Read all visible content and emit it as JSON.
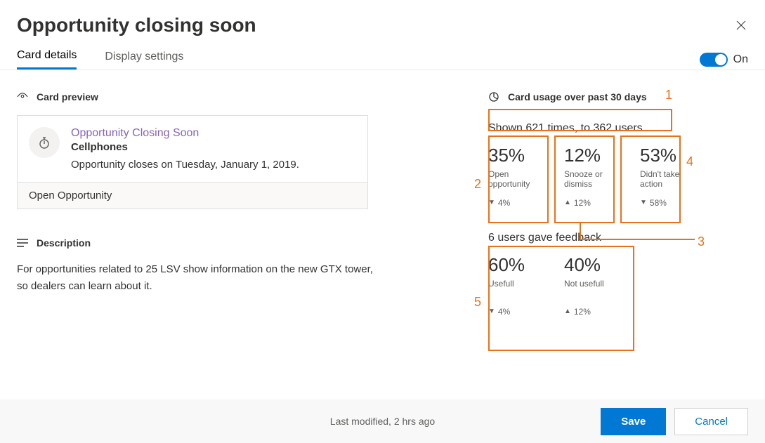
{
  "title": "Opportunity closing soon",
  "tabs": {
    "details": "Card details",
    "display": "Display settings"
  },
  "toggle": {
    "label": "On"
  },
  "preview": {
    "heading": "Card preview",
    "card_title": "Opportunity Closing Soon",
    "card_subtitle": "Cellphones",
    "card_text": "Opportunity closes on Tuesday, January 1, 2019.",
    "action": "Open Opportunity"
  },
  "description": {
    "heading": "Description",
    "text": "For opportunities related to 25 LSV show information on the new GTX tower, so dealers can learn about it."
  },
  "usage": {
    "heading": "Card usage over past 30 days",
    "shown": "Shown 621 times, to 362 users",
    "stats": [
      {
        "pct": "35%",
        "label": "Open opportunity",
        "trend_dir": "▼",
        "trend": "4%"
      },
      {
        "pct": "12%",
        "label": "Snooze or dismiss",
        "trend_dir": "▲",
        "trend": "12%"
      },
      {
        "pct": "53%",
        "label": "Didn't take action",
        "trend_dir": "▼",
        "trend": "58%"
      }
    ],
    "feedback_title": "6 users gave feedback",
    "feedback": [
      {
        "pct": "60%",
        "label": "Usefull",
        "trend_dir": "▼",
        "trend": "4%"
      },
      {
        "pct": "40%",
        "label": "Not usefull",
        "trend_dir": "▲",
        "trend": "12%"
      }
    ]
  },
  "footer": {
    "modified": "Last modified, 2 hrs ago",
    "save": "Save",
    "cancel": "Cancel"
  },
  "annotations": {
    "1": "1",
    "2": "2",
    "3": "3",
    "4": "4",
    "5": "5"
  }
}
